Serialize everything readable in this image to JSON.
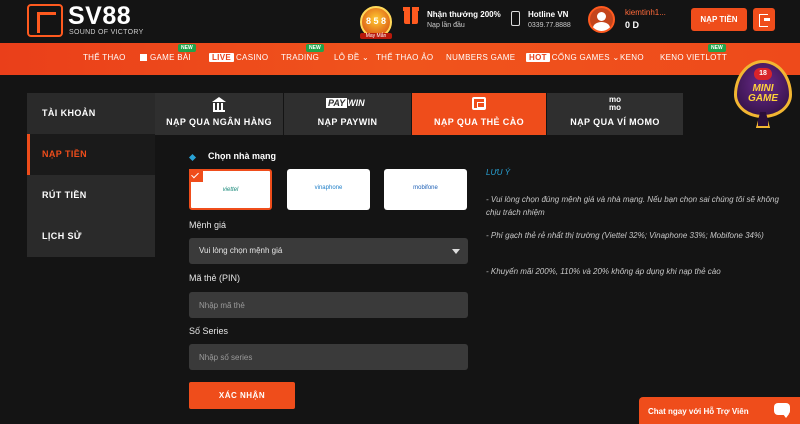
{
  "header": {
    "brand": "SV88",
    "tagline": "SOUND OF VICTORY",
    "badge": {
      "number": "8 5 8",
      "caption": "May Mắn"
    },
    "promo": {
      "title": "Nhận thưởng 200%",
      "subtitle": "Nạp lần đầu"
    },
    "hotline": {
      "label": "Hotline VN",
      "number": "0339.77.8888"
    },
    "user": {
      "name": "kiemtinh1...",
      "balance": "0 D"
    },
    "deposit_button": "NẠP TIỀN"
  },
  "nav": {
    "new_tag": "NEW",
    "live_tag": "LIVE",
    "hot_tag": "HOT",
    "items": [
      {
        "label": "THỂ THAO"
      },
      {
        "label": "GAME BÀI"
      },
      {
        "label": "CASINO"
      },
      {
        "label": "TRADING"
      },
      {
        "label": "LÔ ĐỀ"
      },
      {
        "label": "THỂ THAO ẢO"
      },
      {
        "label": "NUMBERS GAME"
      },
      {
        "label": "CỔNG GAMES"
      },
      {
        "label": "KENO"
      },
      {
        "label": "KENO VIETLOTT"
      }
    ]
  },
  "minigame": {
    "age": "18",
    "line1": "MINI",
    "line2": "GAME"
  },
  "sidebar": {
    "items": [
      {
        "label": "TÀI KHOẢN"
      },
      {
        "label": "NẠP TIỀN"
      },
      {
        "label": "RÚT TIỀN"
      },
      {
        "label": "LỊCH SỬ"
      }
    ]
  },
  "tabs": [
    {
      "label": "NẠP QUA NGÂN HÀNG"
    },
    {
      "label": "NẠP PAYWIN",
      "logo_a": "PAY",
      "logo_b": "WIN"
    },
    {
      "label": "NẠP QUA THẺ CÀO"
    },
    {
      "label": "NẠP QUA VÍ MOMO",
      "logo_a": "mo",
      "logo_b": "mo"
    }
  ],
  "form": {
    "section_title": "Chọn nhà mạng",
    "providers": [
      {
        "label": "viettel"
      },
      {
        "label": "vinaphone"
      },
      {
        "label": "mobifone"
      }
    ],
    "denomination_label": "Mệnh giá",
    "denomination_value": "Vui lòng chọn mệnh giá",
    "pin_label": "Mã thẻ (PIN)",
    "pin_placeholder": "Nhập mã thẻ",
    "serial_label": "Số Series",
    "serial_placeholder": "Nhập số series",
    "submit": "XÁC NHẬN"
  },
  "notes": {
    "title": "LƯU Ý",
    "items": [
      "- Vui lòng chọn đúng mệnh giá và nhà mạng. Nếu bạn chọn sai chúng tôi sẽ không chịu trách nhiệm",
      "- Phí gạch thẻ rẻ nhất thị trường (Viettel 32%; Vinaphone 33%; Mobifone 34%)",
      "- Khuyến mãi 200%, 110% và 20% không áp dụng khi nạp thẻ cào"
    ]
  },
  "chat": {
    "label": "Chat ngay với Hỗ Trợ Viên"
  },
  "colors": {
    "accent": "#ef4d1b",
    "info": "#29a3d6",
    "panel": "#2a2a2a",
    "background": "#141414"
  }
}
